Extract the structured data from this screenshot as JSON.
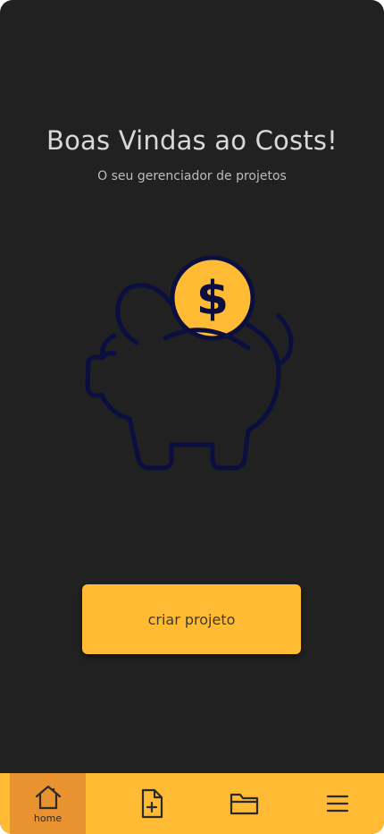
{
  "header": {
    "title": "Boas Vindas ao Costs!",
    "subtitle": "O seu gerenciador de projetos"
  },
  "illustration": {
    "icon": "piggy-bank-coin-icon",
    "coin_symbol": "$",
    "outline_color": "#0a0f3f",
    "coin_color": "#ffbb33"
  },
  "cta": {
    "label": "criar projeto"
  },
  "navbar": {
    "items": [
      {
        "icon": "home-icon",
        "label": "home",
        "active": true
      },
      {
        "icon": "new-file-icon",
        "label": ""
      },
      {
        "icon": "folder-icon",
        "label": ""
      },
      {
        "icon": "menu-icon",
        "label": ""
      }
    ]
  },
  "colors": {
    "background": "#212121",
    "accent": "#ffbb33",
    "active_nav": "#e89230"
  }
}
